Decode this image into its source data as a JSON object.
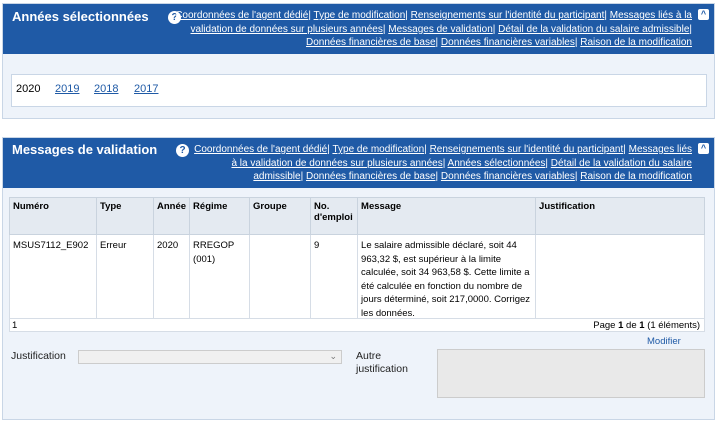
{
  "years_panel": {
    "title": "Années sélectionnées",
    "help": "?",
    "links": [
      "Coordonnées de l'agent dédié",
      "Type de modification",
      "Renseignements sur l'identité du participant",
      "Messages liés à la validation de données sur plusieurs années",
      "Messages de validation",
      "Détail de la validation du salaire admissible",
      "Données financières de base",
      "Données financières variables",
      "Raison de la modification"
    ],
    "years": [
      "2020",
      "2019",
      "2018",
      "2017"
    ]
  },
  "validation_panel": {
    "title": "Messages de validation",
    "help": "?",
    "links": [
      "Coordonnées de l'agent dédié",
      "Type de modification",
      "Renseignements sur l'identité du participant",
      "Messages liés à la validation de données sur plusieurs années",
      "Années sélectionnées",
      "Détail de la validation du salaire admissible",
      "Données financières de base",
      "Données financières variables",
      "Raison de la modification"
    ],
    "table": {
      "headers": [
        "Numéro",
        "Type",
        "Année",
        "Régime",
        "Groupe",
        "No. d'emploi",
        "Message",
        "Justification"
      ],
      "rows": [
        {
          "numero": "MSUS7112_E902",
          "type": "Erreur",
          "annee": "2020",
          "regime": "RREGOP (001)",
          "groupe": "",
          "no_emploi": "9",
          "message": "Le salaire admissible déclaré, soit 44 963,32 $, est supérieur à la limite calculée, soit 34 963,58 $. Cette limite a été calculée en fonction du nombre de jours déterminé, soit 217,0000. Corrigez les données.",
          "justification": ""
        }
      ],
      "footer_count": "1",
      "pager_prefix": "Page ",
      "pager_page": "1",
      "pager_of": " de ",
      "pager_total": "1",
      "pager_suffix": " (1 éléments)"
    },
    "modifier": "Modifier",
    "justification_label": "Justification",
    "autre_label": "Autre justification"
  }
}
